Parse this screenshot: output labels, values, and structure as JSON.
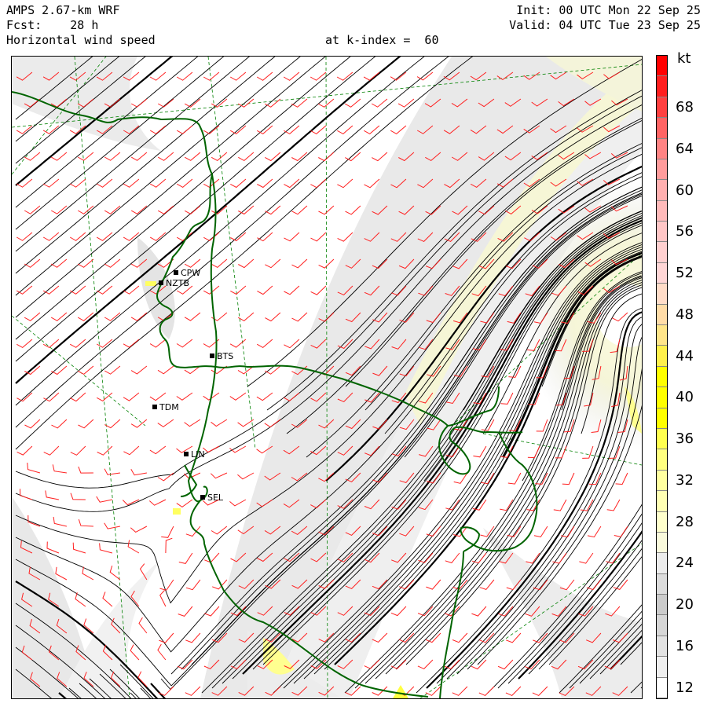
{
  "header": {
    "model": "AMPS 2.67-km WRF",
    "forecast": "Fcst:    28 h",
    "field": "Horizontal wind speed",
    "level": "at k-index =  60",
    "init": "Init: 00 UTC Mon 22 Sep 25",
    "valid": "Valid: 04 UTC Tue 23 Sep 25"
  },
  "colorbar": {
    "unit": "kt",
    "levels": [
      {
        "value": 12,
        "color": "#ffffff"
      },
      {
        "value": 14,
        "color": "#efefef"
      },
      {
        "value": 16,
        "color": "#e2e2e2"
      },
      {
        "value": 18,
        "color": "#d6d6d6"
      },
      {
        "value": 20,
        "color": "#cbcbcb"
      },
      {
        "value": 22,
        "color": "#dcdcdc"
      },
      {
        "value": 24,
        "color": "#ececec"
      },
      {
        "value": 26,
        "color": "#fafadc"
      },
      {
        "value": 28,
        "color": "#ffffcc"
      },
      {
        "value": 30,
        "color": "#ffffb4"
      },
      {
        "value": 32,
        "color": "#ffffa0"
      },
      {
        "value": 34,
        "color": "#ffff80"
      },
      {
        "value": 36,
        "color": "#ffff50"
      },
      {
        "value": 38,
        "color": "#ffff00"
      },
      {
        "value": 40,
        "color": "#ffff00"
      },
      {
        "value": 42,
        "color": "#ffff00"
      },
      {
        "value": 44,
        "color": "#fff04c"
      },
      {
        "value": 46,
        "color": "#ffe58a"
      },
      {
        "value": 48,
        "color": "#ffdca8"
      },
      {
        "value": 50,
        "color": "#ffdcc8"
      },
      {
        "value": 52,
        "color": "#ffd6d6"
      },
      {
        "value": 54,
        "color": "#ffd0d0"
      },
      {
        "value": 56,
        "color": "#ffc6c6"
      },
      {
        "value": 58,
        "color": "#ffbaba"
      },
      {
        "value": 60,
        "color": "#ffb0b0"
      },
      {
        "value": 62,
        "color": "#ff9c9c"
      },
      {
        "value": 64,
        "color": "#ff8484"
      },
      {
        "value": 66,
        "color": "#ff6464"
      },
      {
        "value": 68,
        "color": "#ff4040"
      },
      {
        "value": 70,
        "color": "#ff1e1e"
      },
      {
        "value": 72,
        "color": "#ff0000"
      }
    ],
    "tick_labels": [
      "12",
      "16",
      "20",
      "24",
      "28",
      "32",
      "36",
      "40",
      "44",
      "48",
      "52",
      "56",
      "60",
      "64",
      "68"
    ]
  },
  "stations": [
    "CPW",
    "NZTB",
    "TDM",
    "BTS",
    "SEL",
    "LIN"
  ],
  "colors": {
    "streamline": "#000000",
    "coastline": "#006400",
    "wind_barb": "#ff0000",
    "grid": "#008000"
  }
}
